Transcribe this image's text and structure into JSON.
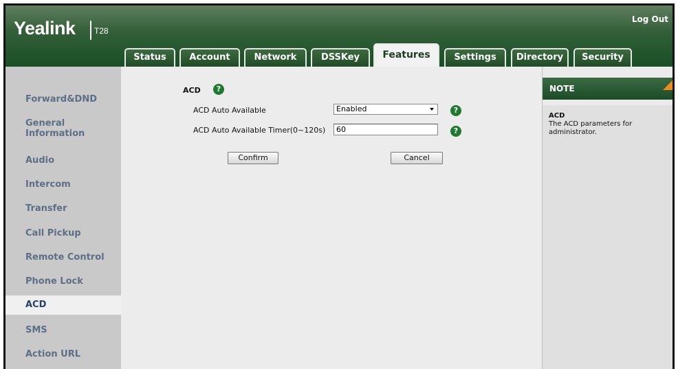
{
  "header": {
    "logo": "Yealink",
    "model": "T28",
    "logout": "Log Out",
    "tabs": [
      {
        "label": "Status"
      },
      {
        "label": "Account"
      },
      {
        "label": "Network"
      },
      {
        "label": "DSSKey"
      },
      {
        "label": "Features",
        "active": true
      },
      {
        "label": "Settings"
      },
      {
        "label": "Directory"
      },
      {
        "label": "Security"
      }
    ]
  },
  "sidebar": {
    "items": [
      {
        "label": "Forward&DND"
      },
      {
        "label": "General Information"
      },
      {
        "label": "Audio"
      },
      {
        "label": "Intercom"
      },
      {
        "label": "Transfer"
      },
      {
        "label": "Call Pickup"
      },
      {
        "label": "Remote Control"
      },
      {
        "label": "Phone Lock"
      },
      {
        "label": "ACD",
        "active": true
      },
      {
        "label": "SMS"
      },
      {
        "label": "Action URL"
      }
    ]
  },
  "main": {
    "section_title": "ACD",
    "auto_available": {
      "label": "ACD Auto Available",
      "value": "Enabled"
    },
    "auto_available_timer": {
      "label": "ACD Auto Available Timer(0~120s)",
      "value": "60"
    },
    "confirm_label": "Confirm",
    "cancel_label": "Cancel"
  },
  "note": {
    "header": "NOTE",
    "title": "ACD",
    "text": "The ACD parameters for administrator."
  },
  "colors": {
    "header_green": "#184f25",
    "accent_orange": "#f08c1e",
    "sidebar_text": "#5d6f86"
  }
}
